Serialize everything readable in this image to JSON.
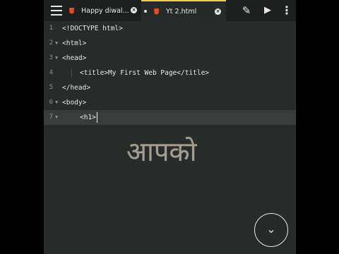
{
  "tabs": [
    {
      "label": "Happy diwal...",
      "active": false
    },
    {
      "label": "Yt 2.html",
      "active": true
    }
  ],
  "toolbar": {
    "menu_icon": "menu-icon",
    "edit_icon": "pencil-icon",
    "run_icon": "play-icon",
    "more_icon": "more-vert-icon"
  },
  "editor": {
    "lines": [
      {
        "num": "1",
        "text": "<!DOCTYPE html>"
      },
      {
        "num": "2",
        "text": "<html>"
      },
      {
        "num": "3",
        "text": "<head>"
      },
      {
        "num": "4",
        "text": "<title>My First Web Page</title>"
      },
      {
        "num": "5",
        "text": "</head>"
      },
      {
        "num": "6",
        "text": "<body>"
      },
      {
        "num": "7",
        "text": "<h1>"
      }
    ]
  },
  "overlay": {
    "text": "आपको"
  },
  "fab": {
    "icon": "chevron-down-icon",
    "glyph": "⌄"
  },
  "colors": {
    "background": "#272b2a",
    "topbar": "#1d201f",
    "active_tab_accent": "#f2c94c",
    "html5": "#e44d26",
    "active_line": "#383d3c",
    "overlay_text": "#a39e90"
  }
}
